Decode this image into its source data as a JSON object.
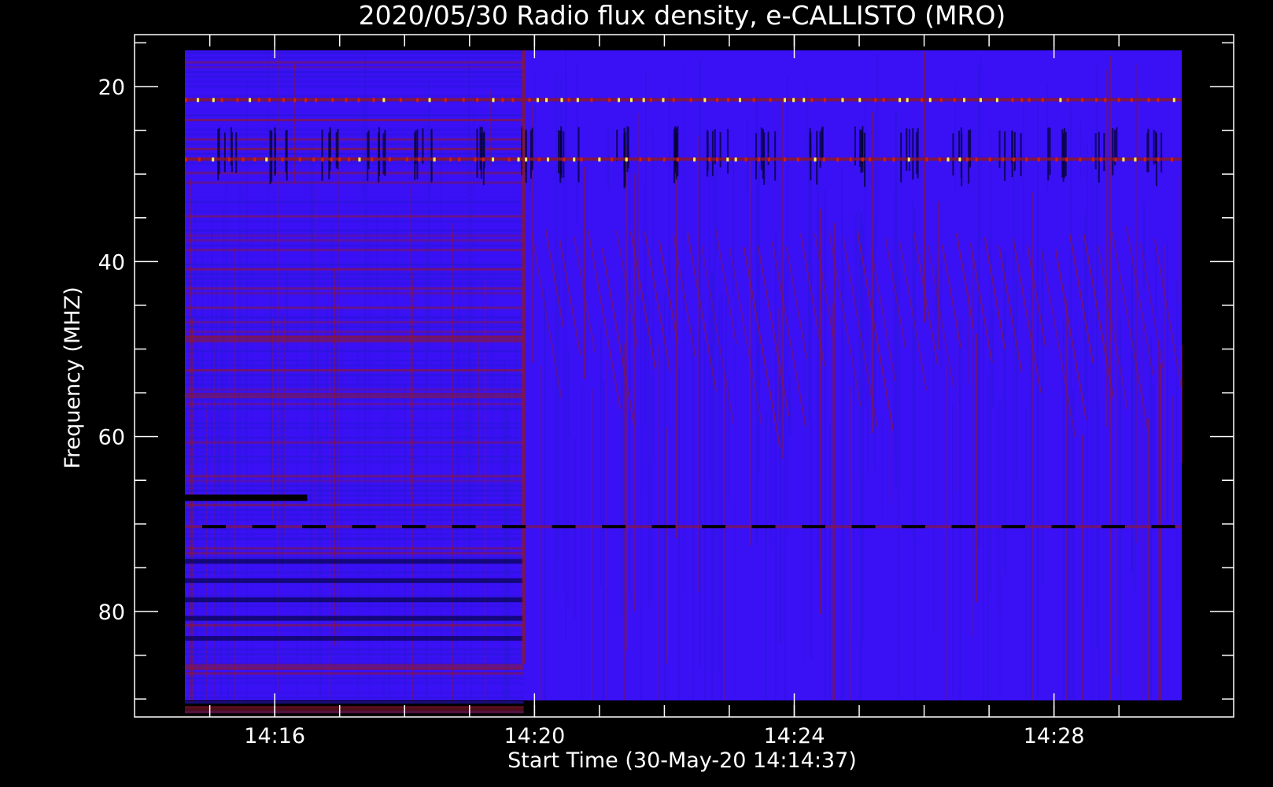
{
  "chart_data": {
    "type": "heatmap",
    "title": "2020/05/30  Radio flux density, e-CALLISTO (MRO)",
    "xlabel": "Start Time (30-May-20 14:14:37)",
    "ylabel": "Frequency (MHZ)",
    "x_ticks": [
      "14:16",
      "14:20",
      "14:24",
      "14:28"
    ],
    "y_ticks": [
      "20",
      "40",
      "60",
      "80"
    ],
    "x_range": [
      "14:14:37",
      "14:29:58"
    ],
    "ylim": [
      15,
      92
    ],
    "y_inverted": true,
    "colormap": [
      "#000000",
      "#2a16d8",
      "#3a10f5",
      "#8a1830",
      "#d02010",
      "#ffff60"
    ],
    "background": "#000000",
    "features": [
      {
        "kind": "horizontal-band",
        "freq_mhz": 21.5,
        "from": "14:14:37",
        "to": "14:29:58",
        "level": "bright"
      },
      {
        "kind": "horizontal-band",
        "freq_mhz": 28.3,
        "from": "14:14:37",
        "to": "14:29:58",
        "level": "bright"
      },
      {
        "kind": "horizontal-band",
        "freq_mhz": 67.0,
        "from": "14:14:37",
        "to": "14:16:30",
        "level": "dark"
      },
      {
        "kind": "horizontal-band",
        "freq_mhz": 70.3,
        "from": "14:14:37",
        "to": "14:29:58",
        "level": "dark-dashed"
      },
      {
        "kind": "vertical-edge",
        "time": "14:19:50",
        "level": "red"
      }
    ]
  }
}
